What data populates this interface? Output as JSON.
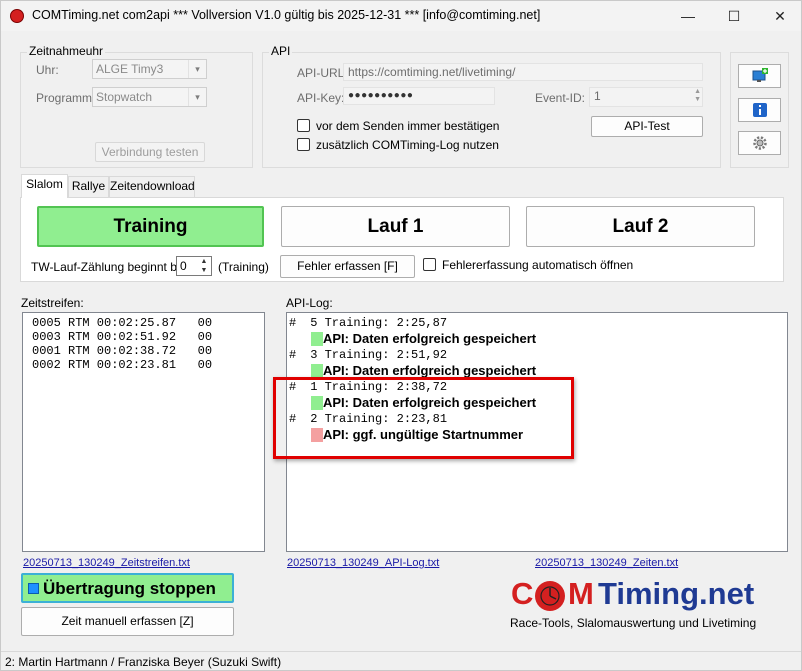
{
  "window": {
    "title": "COMTiming.net com2api *** Vollversion V1.0 gültig bis 2025-12-31 *** [info@comtiming.net]",
    "minimize": "—",
    "maximize": "☐",
    "close": "✕"
  },
  "zeitnahme": {
    "group_title": "Zeitnahmeuhr",
    "uhr_label": "Uhr:",
    "uhr_value": "ALGE Timy3",
    "programm_label": "Programm:",
    "programm_value": "Stopwatch",
    "test_button": "Verbindung testen"
  },
  "api": {
    "group_title": "API",
    "url_label": "API-URL:",
    "url_value": "https://comtiming.net/livetiming/",
    "key_label": "API-Key:",
    "key_value": "●●●●●●●●●●",
    "event_label": "Event-ID:",
    "event_value": "1",
    "confirm_label": "vor dem Senden immer bestätigen",
    "log_label": "zusätzlich COMTiming-Log nutzen",
    "test_button": "API-Test"
  },
  "side_icons": [
    "monitor-add-icon",
    "info-icon",
    "settings-gear-icon"
  ],
  "tabs": [
    "Slalom",
    "Rallye",
    "Zeitendownload"
  ],
  "slalom": {
    "training": "Training",
    "lauf1": "Lauf 1",
    "lauf2": "Lauf 2",
    "tw_label": "TW-Lauf-Zählung beginnt bei:",
    "tw_value": "0",
    "tw_suffix": "(Training)",
    "fehler_button": "Fehler erfassen [F]",
    "fehler_auto_label": "Fehlererfassung automatisch öffnen"
  },
  "zeitstreifen": {
    "label": "Zeitstreifen:",
    "rows": [
      "0005 RTM 00:02:25.87   00",
      "0003 RTM 00:02:51.92   00",
      "0001 RTM 00:02:38.72   00",
      "0002 RTM 00:02:23.81   00"
    ],
    "file_link": "20250713_130249_Zeitstreifen.txt"
  },
  "api_log": {
    "label": "API-Log:",
    "entries": [
      {
        "hash": "#",
        "line": " 5 Training: 2:25,87",
        "status": "API: Daten erfolgreich gespeichert",
        "status_color": "#90ee90"
      },
      {
        "hash": "#",
        "line": " 3 Training: 2:51,92",
        "status": "API: Daten erfolgreich gespeichert",
        "status_color": "#90ee90"
      },
      {
        "hash": "#",
        "line": " 1 Training: 2:38,72",
        "status": "API: Daten erfolgreich gespeichert",
        "status_color": "#90ee90"
      },
      {
        "hash": "#",
        "line": " 2 Training: 2:23,81",
        "status": "API: ggf. ungültige Startnummer",
        "status_color": "#f4a0a0"
      }
    ],
    "file_link": "20250713_130249_API-Log.txt",
    "zeiten_link": "20250713_130249_Zeiten.txt"
  },
  "stop_button": "Übertragung stoppen",
  "manual_button": "Zeit manuell erfassen [Z]",
  "logo": {
    "prefix": "C",
    "mid": "M",
    "suffix": "Timing.net",
    "tagline": "Race-Tools, Slalomauswertung und Livetiming",
    "red": "#d42020",
    "blue": "#1f3a93"
  },
  "status": "2: Martin  Hartmann / Franziska  Beyer (Suzuki  Swift)"
}
